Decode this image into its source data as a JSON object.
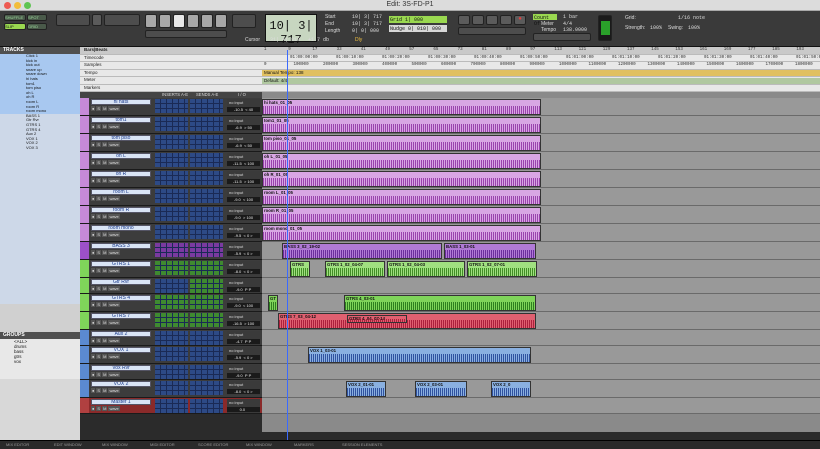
{
  "window": {
    "title": "Edit: 3S-FD-P1"
  },
  "toolbar": {
    "shuffle": "SHUFFLE",
    "spot": "SPOT",
    "slip": "SLIP",
    "grid": "GRID",
    "counter": "10| 3| 717",
    "start_label": "Start",
    "start_val": "10| 3| 717",
    "end_label": "End",
    "end_val": "10| 3| 717",
    "length_label": "Length",
    "length_val": "0| 0| 000",
    "cursor_label": "Cursor",
    "cursor_val": "31| 4| 819",
    "cursor_db": "+1.7 db",
    "dly": "Dly",
    "grid_label": "Grid",
    "grid_val": "1| 000",
    "nudge_label": "Nudge",
    "nudge_val": "0| 010| 000",
    "countoff": "Count Off",
    "meter": "Meter",
    "tempo": "Tempo",
    "bar_val": "1 bar",
    "meter_val": "4/4",
    "tempo_val": "138.0000",
    "grid_note_label": "Grid:",
    "grid_note": "1/16 note",
    "strength_label": "Strength:",
    "strength": "100%",
    "swing_label": "Swing:",
    "swing": "100%"
  },
  "left": {
    "tracks_hdr": "TRACKS",
    "track_list": [
      "Click 1",
      "kick in",
      "kick out",
      "snare up",
      "snare down",
      "hi hats",
      "tom1",
      "tom piso",
      "oh L",
      "oh R",
      "room L",
      "room R",
      "room mono",
      "BASS 1",
      "Gtr Rvr",
      "GTRS 1",
      "GTRS 4",
      "Aux 2",
      "VOX 1",
      "VOX 2",
      "VOX 3"
    ],
    "groups_hdr": "GROUPS",
    "groups": [
      "<ALL>",
      "drums",
      "bass",
      "gtrs",
      "vox"
    ]
  },
  "rulers": {
    "rows": [
      "Bars|Beats",
      "Timecode",
      "Samples",
      "Tempo",
      "Meter",
      "Markers"
    ],
    "bars": [
      "1",
      "9",
      "17",
      "33",
      "41",
      "49",
      "57",
      "65",
      "73",
      "81",
      "89",
      "97",
      "113",
      "121",
      "129",
      "137",
      "145",
      "153",
      "161",
      "169",
      "177",
      "185",
      "193",
      "201"
    ],
    "timecode": [
      "01:00:00:00",
      "01:00:10:00",
      "01:00:20:00",
      "01:00:30:00",
      "01:00:40:00",
      "01:00:50:00",
      "01:01:00:00",
      "01:01:10:00",
      "01:01:20:00",
      "01:01:30:00",
      "01:01:40:00",
      "01:01:50:00"
    ],
    "samples": [
      "0",
      "100000",
      "200000",
      "300000",
      "400000",
      "500000",
      "600000",
      "700000",
      "800000",
      "900000",
      "1000000",
      "1100000",
      "1200000",
      "1300000",
      "1400000",
      "1500000",
      "1600000",
      "1700000",
      "1800000"
    ],
    "tempo_marker": "Manual Tempo: 138",
    "meter_marker": "Default: 4/4"
  },
  "mix_headers": {
    "inserts": "INSERTS A-E",
    "sends": "SENDS A-E",
    "io": "I / O"
  },
  "tracks": [
    {
      "name": "hi hats",
      "vol": "-10.5",
      "pan": "< 40",
      "color": "#c68ad8",
      "type": "audio"
    },
    {
      "name": "tom1",
      "vol": "-6.9",
      "pan": "> 50",
      "color": "#c68ad8",
      "type": "audio"
    },
    {
      "name": "tom piso",
      "vol": "-6.9",
      "pan": "< 50",
      "color": "#c68ad8",
      "type": "audio"
    },
    {
      "name": "oh L",
      "vol": "-11.5",
      "pan": "< 100",
      "color": "#c68ad8",
      "type": "audio"
    },
    {
      "name": "oh R",
      "vol": "-11.5",
      "pan": "> 100",
      "color": "#c68ad8",
      "type": "audio"
    },
    {
      "name": "room L",
      "vol": "-9.0",
      "pan": "< 100",
      "color": "#c68ad8",
      "type": "audio"
    },
    {
      "name": "room R",
      "vol": "-9.0",
      "pan": "> 100",
      "color": "#c68ad8",
      "type": "audio"
    },
    {
      "name": "room mono",
      "vol": "-9.5",
      "pan": "< 0 >",
      "color": "#c68ad8",
      "type": "audio"
    },
    {
      "name": "BASS 3",
      "vol": "-5.9",
      "pan": "< 0 >",
      "color": "#9c50c8",
      "type": "audio"
    },
    {
      "name": "GTRS 1",
      "vol": "-8.0",
      "pan": "< 0 >",
      "color": "#7fd45a",
      "type": "audio"
    },
    {
      "name": "Gtr Rvr",
      "vol": "-9.0",
      "pan": "P P",
      "color": "#7fd45a",
      "type": "aux"
    },
    {
      "name": "GTRS 4",
      "vol": "-9.0",
      "pan": "< 100",
      "color": "#7fd45a",
      "type": "audio"
    },
    {
      "name": "GTRS 7",
      "vol": "-16.5",
      "pan": "> 100",
      "color": "#7fd45a",
      "type": "audio"
    },
    {
      "name": "Aux 2",
      "vol": "-4.7",
      "pan": "P P",
      "color": "#5b8ad0",
      "type": "aux"
    },
    {
      "name": "VOX 1",
      "vol": "-5.9",
      "pan": "< 0 >",
      "color": "#5b8ad0",
      "type": "audio"
    },
    {
      "name": "Vox Rvr",
      "vol": "-9.0",
      "pan": "P P",
      "color": "#5b8ad0",
      "type": "aux"
    },
    {
      "name": "VOX 2",
      "vol": "-8.0",
      "pan": "< 0 >",
      "color": "#5b8ad0",
      "type": "audio"
    },
    {
      "name": "Master 1",
      "vol": "0.0",
      "pan": "",
      "color": "#b04040",
      "type": "master"
    }
  ],
  "clip_labels": {
    "hihats": "hi hats_01_05",
    "tom1": "tom1_01_05",
    "tompiso": "tom piso_01_05",
    "ohL": "oh L_01_05",
    "ohR": "oh R_01_05",
    "roomL": "room L_01_05",
    "roomR": "room R_01_05",
    "roommono": "room mono_01_05",
    "bass_a": "BASS 3_02_19-02",
    "bass_b": "BASS 1_03-01",
    "gtrs1": "GTRS",
    "gtrs1b": "GTRS 1_02_04-07",
    "gtrs1c": "GTRS 1_02_04-03",
    "gtrs1d": "GTRS 1_02_07-01",
    "gtr4": "GTRS 4_03-01",
    "gtr4b": "GT",
    "gtr7": "GTRS 7_03_04-12",
    "gtr7b": "GTRS 4_04_07-14",
    "vox1": "VOX 1_03-01",
    "vox2a": "VOX 2_01-01",
    "vox2b": "VOX 2_03-01",
    "vox2c": "VOX 2_0"
  },
  "bottom": [
    "MIX EDITOR",
    "EDIT WINDOW",
    "MIX WINDOW",
    "MIDI EDITOR",
    "SCORE EDITOR",
    "MIX WINDOW",
    "MARKERS",
    "SESSION ELEMENTS"
  ]
}
